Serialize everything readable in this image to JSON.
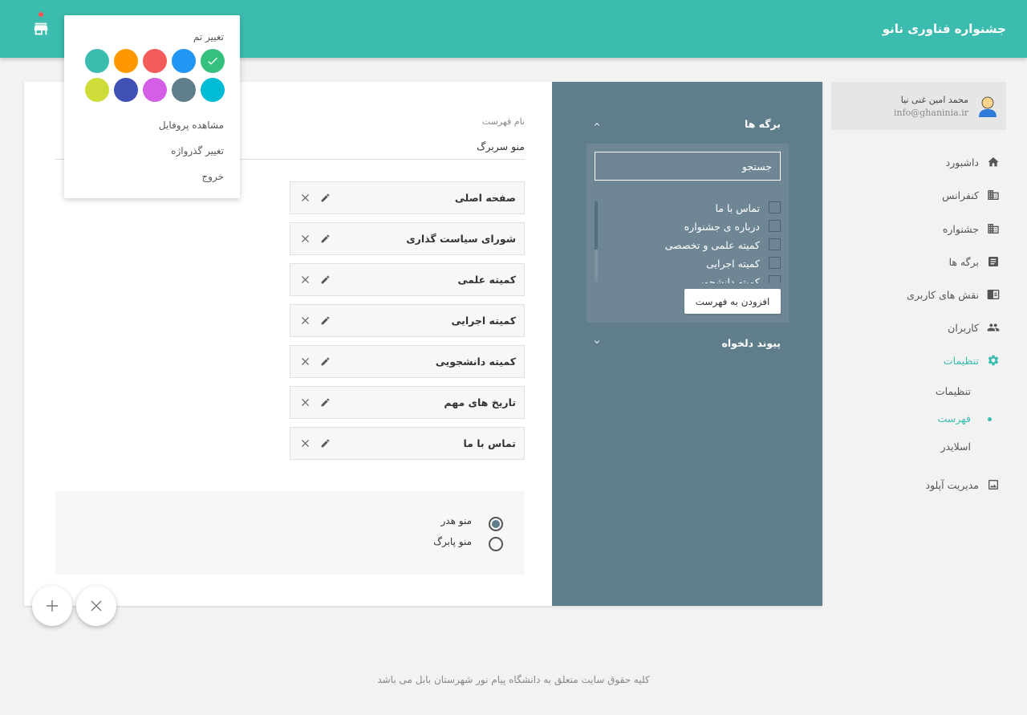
{
  "header": {
    "site_title": "جشنواره فناوری نانو",
    "store_icon": "store-icon"
  },
  "theme_menu": {
    "title": "تغییر تم",
    "colors": [
      "#3bbcaf",
      "#ff9800",
      "#f45b5b",
      "#2196f3",
      "#35c07e",
      "#cddc39",
      "#3f51b5",
      "#d45fe6",
      "#607d8b",
      "#00bcd4"
    ],
    "selected_color": "#35c07e",
    "items": [
      "مشاهده پروفایل",
      "تغییر گذرواژه",
      "خروج"
    ]
  },
  "user": {
    "name": "محمد امین غنی نیا",
    "email": "info@ghaninia.ir"
  },
  "sidebar": {
    "items": [
      {
        "label": "داشبورد",
        "icon": "home-icon"
      },
      {
        "label": "کنفرانس",
        "icon": "building-icon"
      },
      {
        "label": "جشنواره",
        "icon": "building-icon"
      },
      {
        "label": "برگه ها",
        "icon": "document-icon"
      },
      {
        "label": "نقش های کاربری",
        "icon": "roles-icon"
      },
      {
        "label": "کاربران",
        "icon": "users-icon"
      },
      {
        "label": "تنظیمات",
        "icon": "gear-icon"
      }
    ],
    "subitems": [
      "تنظیمات",
      "فهرست",
      "اسلایدر"
    ],
    "upload": {
      "label": "مدیریت آپلود",
      "icon": "image-icon"
    }
  },
  "pages_panel": {
    "title": "برگه ها",
    "search_placeholder": "جستجو",
    "pages": [
      "تماس با ما",
      "درباره ی جشنواره",
      "کمیته علمی و تخصصی",
      "کمیته اجرایی",
      "کمیته دانشجویی"
    ],
    "add_button": "افزودن به فهرست"
  },
  "custom_link": {
    "title": "پیوند دلخواه"
  },
  "menu_form": {
    "name_label": "نام فهرست",
    "name_value": "منو سربرگ"
  },
  "menu_items": [
    "صفحه اصلی",
    "شورای سیاست گذاری",
    "کمیته علمی",
    "کمیته اجرایی",
    "کمیته دانشجویی",
    "تاریخ های مهم",
    "تماس با ما"
  ],
  "menu_location": {
    "options": [
      "منو هدر",
      "منو پابرگ"
    ],
    "selected": "منو هدر"
  },
  "footer": {
    "text": "کلیه حقوق سایت متعلق به دانشگاه پیام نور شهرستان بابل می باشد"
  }
}
